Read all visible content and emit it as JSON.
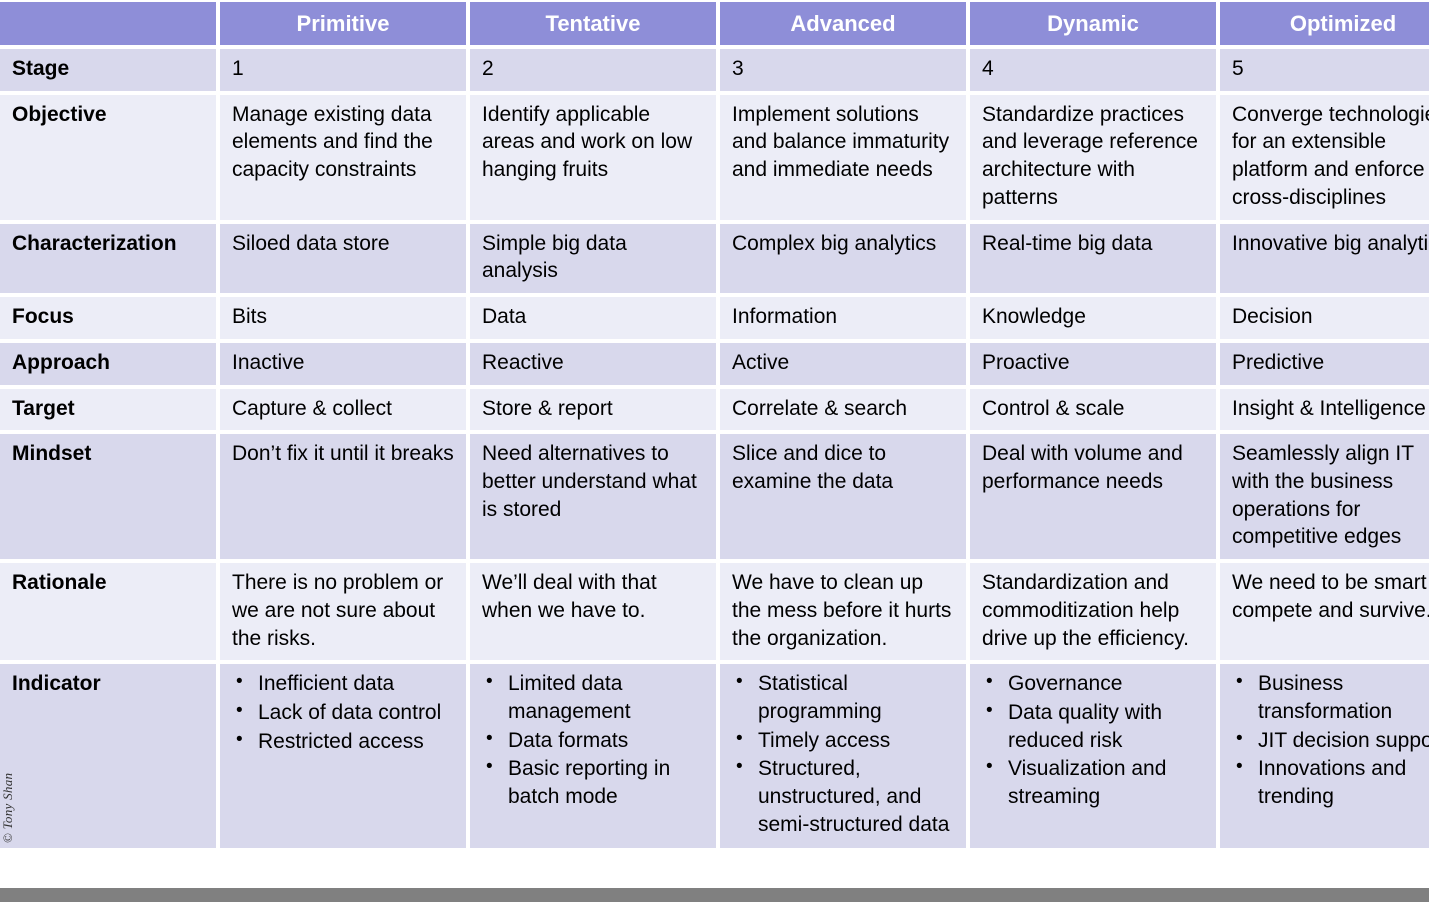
{
  "header": {
    "corner_label": "",
    "columns": [
      "Primitive",
      "Tentative",
      "Advanced",
      "Dynamic",
      "Optimized"
    ]
  },
  "colors": {
    "header_purple": "#8e8ed8",
    "row_dark": "#d8d8ec",
    "row_light": "#ecedf7",
    "gap_white": "#ffffff",
    "footer_gray": "#808080",
    "text": "#000000",
    "header_text": "#ffffff"
  },
  "watermark": "© Tony Shan",
  "rows": [
    {
      "label": "Stage",
      "type": "text",
      "cells": [
        "1",
        "2",
        "3",
        "4",
        "5"
      ]
    },
    {
      "label": "Objective",
      "type": "text",
      "cells": [
        "Manage existing data elements and find the capacity constraints",
        "Identify applicable areas and work on low hanging fruits",
        "Implement solutions and balance immaturity and immediate needs",
        "Standardize practices and leverage reference architecture with patterns",
        "Converge technologies for an extensible platform and enforce cross-disciplines"
      ]
    },
    {
      "label": "Characterization",
      "type": "text",
      "cells": [
        "Siloed data store",
        "Simple big data analysis",
        "Complex big analytics",
        "Real-time big data",
        "Innovative big analytics"
      ]
    },
    {
      "label": "Focus",
      "type": "text",
      "cells": [
        "Bits",
        "Data",
        "Information",
        "Knowledge",
        "Decision"
      ]
    },
    {
      "label": "Approach",
      "type": "text",
      "cells": [
        "Inactive",
        "Reactive",
        "Active",
        "Proactive",
        "Predictive"
      ]
    },
    {
      "label": "Target",
      "type": "text",
      "cells": [
        "Capture & collect",
        "Store & report",
        "Correlate & search",
        "Control & scale",
        "Insight & Intelligence"
      ]
    },
    {
      "label": "Mindset",
      "type": "text",
      "cells": [
        "Don’t fix it until it breaks",
        "Need alternatives to better understand what is stored",
        "Slice and dice to examine the data",
        "Deal with volume and performance needs",
        "Seamlessly align IT with the business operations for competitive edges"
      ]
    },
    {
      "label": "Rationale",
      "type": "text",
      "cells": [
        "There is no problem or we are not sure about the risks.",
        "We’ll deal with that when we have to.",
        "We have to clean up the mess before it hurts the organization.",
        "Standardization and commoditization help drive up the efficiency.",
        "We need to be smart to compete and survive."
      ]
    },
    {
      "label": "Indicator",
      "type": "bullets",
      "cells": [
        [
          "Inefficient data",
          "Lack of data control",
          "Restricted access"
        ],
        [
          "Limited data management",
          "Data formats",
          "Basic reporting in batch mode"
        ],
        [
          "Statistical programming",
          "Timely access",
          "Structured, unstructured, and semi-structured data"
        ],
        [
          "Governance",
          "Data quality with reduced risk",
          "Visualization and streaming"
        ],
        [
          "Business transformation",
          "JIT decision support",
          "Innovations and trending"
        ]
      ]
    }
  ]
}
